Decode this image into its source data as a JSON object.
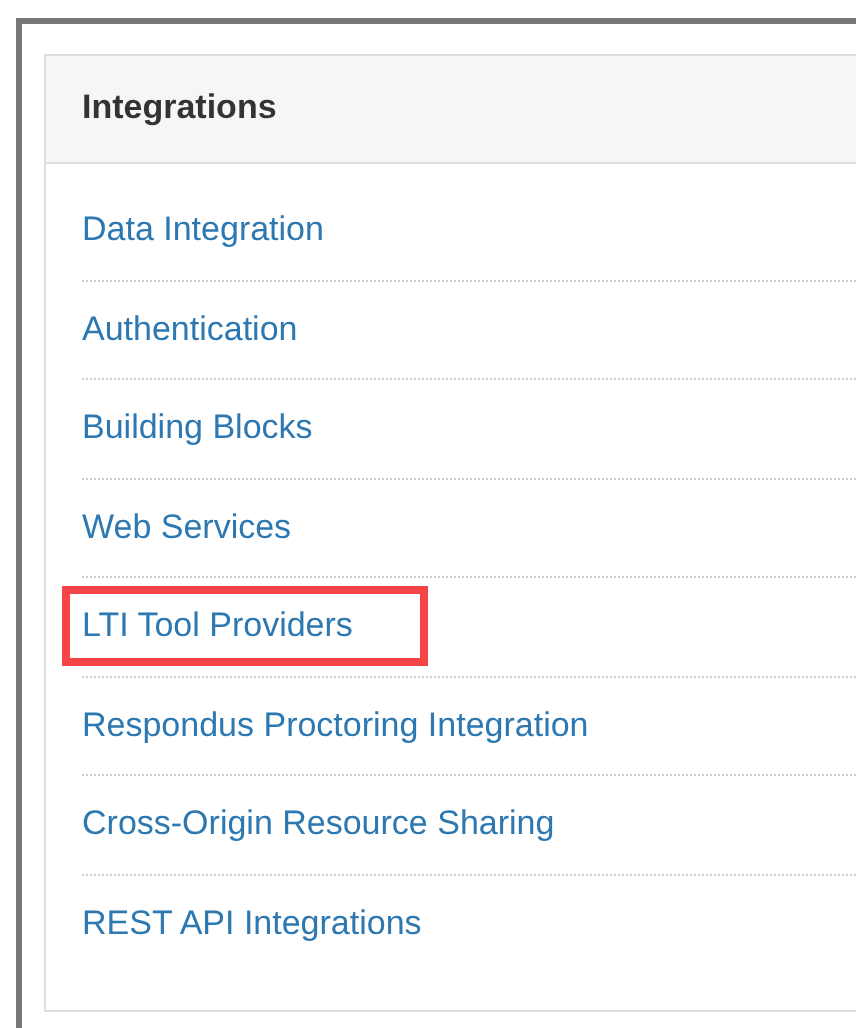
{
  "panel": {
    "title": "Integrations"
  },
  "items": [
    {
      "label": "Data Integration",
      "highlighted": false
    },
    {
      "label": "Authentication",
      "highlighted": false
    },
    {
      "label": "Building Blocks",
      "highlighted": false
    },
    {
      "label": "Web Services",
      "highlighted": false
    },
    {
      "label": "LTI Tool Providers",
      "highlighted": true
    },
    {
      "label": "Respondus Proctoring Integration",
      "highlighted": false
    },
    {
      "label": "Cross-Origin Resource Sharing",
      "highlighted": false
    },
    {
      "label": "REST API Integrations",
      "highlighted": false
    }
  ]
}
